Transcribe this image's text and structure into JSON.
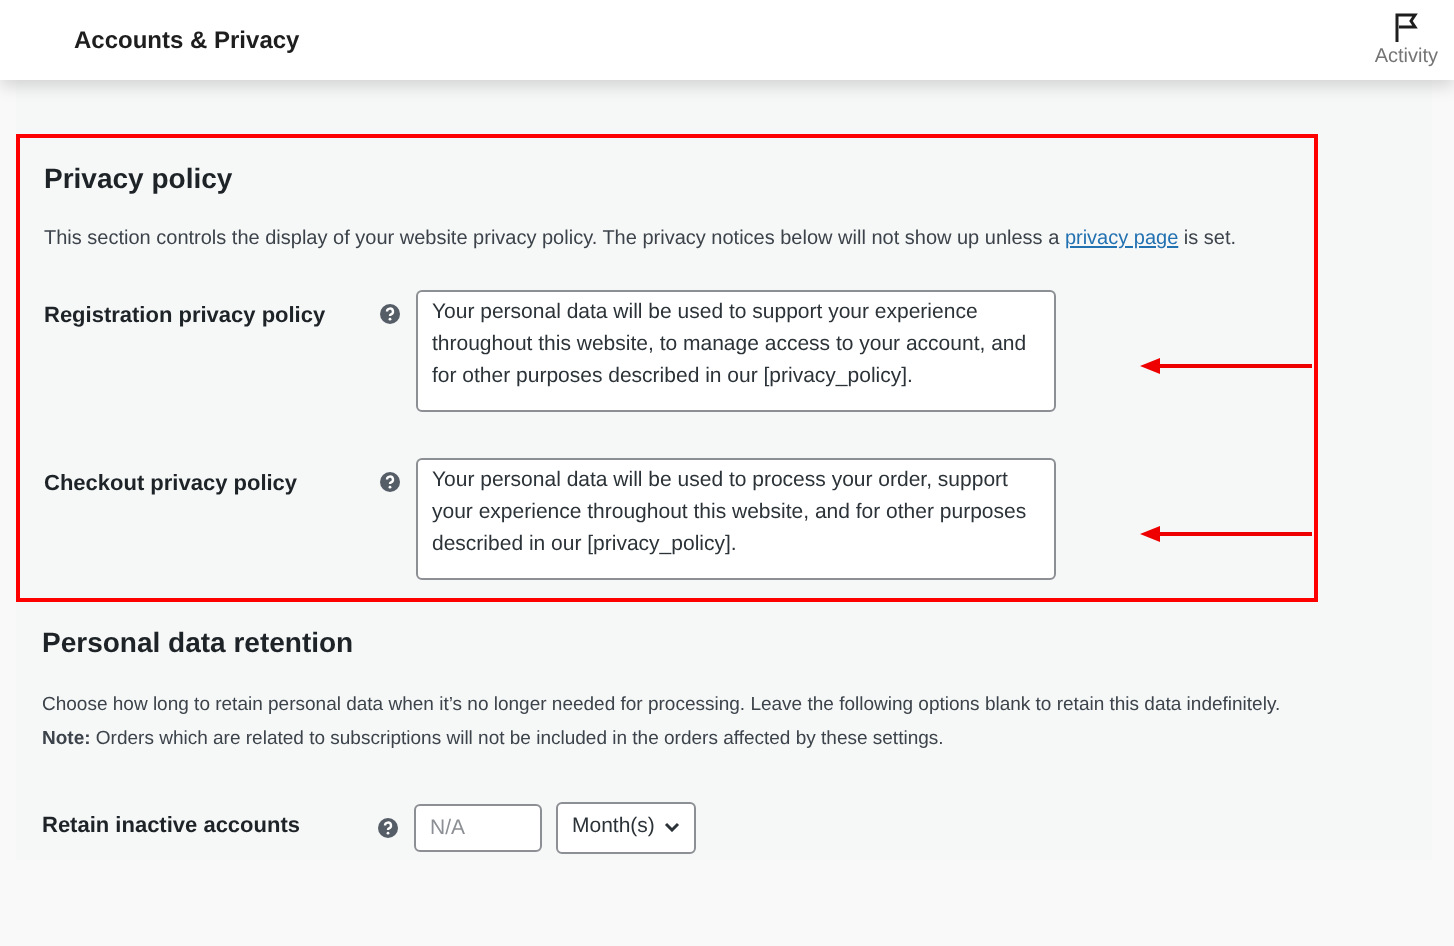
{
  "header": {
    "title": "Accounts & Privacy",
    "activity_label": "Activity"
  },
  "privacy_policy": {
    "heading": "Privacy policy",
    "description_before": "This section controls the display of your website privacy policy. The privacy notices below will not show up unless a",
    "link": "privacy page",
    "description_after": "is set.",
    "fields": [
      {
        "label": "Registration privacy policy",
        "value": "Your personal data will be used to support your experience throughout this website, to manage access to your account, and for other purposes described in our [privacy_policy]."
      },
      {
        "label": "Checkout privacy policy",
        "value": "Your personal data will be used to process your order, support your experience throughout this website, and for other purposes described in our [privacy_policy]."
      }
    ]
  },
  "retention": {
    "heading": "Personal data retention",
    "description": "Choose how long to retain personal data when it’s no longer needed for processing. Leave the following options blank to retain this data indefinitely.",
    "note": "**Note:** Orders which are related to subscriptions will not be included in the orders affected by these settings.",
    "fields": [
      {
        "label": "Retain inactive accounts",
        "placeholder": "N/A",
        "unit": "Month(s)"
      }
    ]
  }
}
